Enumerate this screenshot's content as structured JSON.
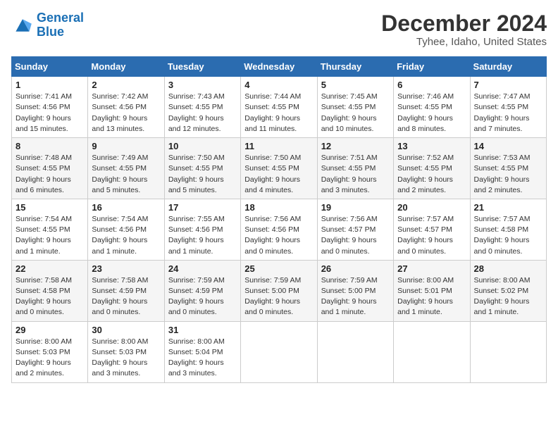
{
  "logo": {
    "line1": "General",
    "line2": "Blue"
  },
  "title": "December 2024",
  "subtitle": "Tyhee, Idaho, United States",
  "weekdays": [
    "Sunday",
    "Monday",
    "Tuesday",
    "Wednesday",
    "Thursday",
    "Friday",
    "Saturday"
  ],
  "weeks": [
    [
      {
        "day": "1",
        "sunrise": "7:41 AM",
        "sunset": "4:56 PM",
        "daylight": "9 hours and 15 minutes."
      },
      {
        "day": "2",
        "sunrise": "7:42 AM",
        "sunset": "4:56 PM",
        "daylight": "9 hours and 13 minutes."
      },
      {
        "day": "3",
        "sunrise": "7:43 AM",
        "sunset": "4:55 PM",
        "daylight": "9 hours and 12 minutes."
      },
      {
        "day": "4",
        "sunrise": "7:44 AM",
        "sunset": "4:55 PM",
        "daylight": "9 hours and 11 minutes."
      },
      {
        "day": "5",
        "sunrise": "7:45 AM",
        "sunset": "4:55 PM",
        "daylight": "9 hours and 10 minutes."
      },
      {
        "day": "6",
        "sunrise": "7:46 AM",
        "sunset": "4:55 PM",
        "daylight": "9 hours and 8 minutes."
      },
      {
        "day": "7",
        "sunrise": "7:47 AM",
        "sunset": "4:55 PM",
        "daylight": "9 hours and 7 minutes."
      }
    ],
    [
      {
        "day": "8",
        "sunrise": "7:48 AM",
        "sunset": "4:55 PM",
        "daylight": "9 hours and 6 minutes."
      },
      {
        "day": "9",
        "sunrise": "7:49 AM",
        "sunset": "4:55 PM",
        "daylight": "9 hours and 5 minutes."
      },
      {
        "day": "10",
        "sunrise": "7:50 AM",
        "sunset": "4:55 PM",
        "daylight": "9 hours and 5 minutes."
      },
      {
        "day": "11",
        "sunrise": "7:50 AM",
        "sunset": "4:55 PM",
        "daylight": "9 hours and 4 minutes."
      },
      {
        "day": "12",
        "sunrise": "7:51 AM",
        "sunset": "4:55 PM",
        "daylight": "9 hours and 3 minutes."
      },
      {
        "day": "13",
        "sunrise": "7:52 AM",
        "sunset": "4:55 PM",
        "daylight": "9 hours and 2 minutes."
      },
      {
        "day": "14",
        "sunrise": "7:53 AM",
        "sunset": "4:55 PM",
        "daylight": "9 hours and 2 minutes."
      }
    ],
    [
      {
        "day": "15",
        "sunrise": "7:54 AM",
        "sunset": "4:55 PM",
        "daylight": "9 hours and 1 minute."
      },
      {
        "day": "16",
        "sunrise": "7:54 AM",
        "sunset": "4:56 PM",
        "daylight": "9 hours and 1 minute."
      },
      {
        "day": "17",
        "sunrise": "7:55 AM",
        "sunset": "4:56 PM",
        "daylight": "9 hours and 1 minute."
      },
      {
        "day": "18",
        "sunrise": "7:56 AM",
        "sunset": "4:56 PM",
        "daylight": "9 hours and 0 minutes."
      },
      {
        "day": "19",
        "sunrise": "7:56 AM",
        "sunset": "4:57 PM",
        "daylight": "9 hours and 0 minutes."
      },
      {
        "day": "20",
        "sunrise": "7:57 AM",
        "sunset": "4:57 PM",
        "daylight": "9 hours and 0 minutes."
      },
      {
        "day": "21",
        "sunrise": "7:57 AM",
        "sunset": "4:58 PM",
        "daylight": "9 hours and 0 minutes."
      }
    ],
    [
      {
        "day": "22",
        "sunrise": "7:58 AM",
        "sunset": "4:58 PM",
        "daylight": "9 hours and 0 minutes."
      },
      {
        "day": "23",
        "sunrise": "7:58 AM",
        "sunset": "4:59 PM",
        "daylight": "9 hours and 0 minutes."
      },
      {
        "day": "24",
        "sunrise": "7:59 AM",
        "sunset": "4:59 PM",
        "daylight": "9 hours and 0 minutes."
      },
      {
        "day": "25",
        "sunrise": "7:59 AM",
        "sunset": "5:00 PM",
        "daylight": "9 hours and 0 minutes."
      },
      {
        "day": "26",
        "sunrise": "7:59 AM",
        "sunset": "5:00 PM",
        "daylight": "9 hours and 1 minute."
      },
      {
        "day": "27",
        "sunrise": "8:00 AM",
        "sunset": "5:01 PM",
        "daylight": "9 hours and 1 minute."
      },
      {
        "day": "28",
        "sunrise": "8:00 AM",
        "sunset": "5:02 PM",
        "daylight": "9 hours and 1 minute."
      }
    ],
    [
      {
        "day": "29",
        "sunrise": "8:00 AM",
        "sunset": "5:03 PM",
        "daylight": "9 hours and 2 minutes."
      },
      {
        "day": "30",
        "sunrise": "8:00 AM",
        "sunset": "5:03 PM",
        "daylight": "9 hours and 3 minutes."
      },
      {
        "day": "31",
        "sunrise": "8:00 AM",
        "sunset": "5:04 PM",
        "daylight": "9 hours and 3 minutes."
      },
      null,
      null,
      null,
      null
    ]
  ]
}
